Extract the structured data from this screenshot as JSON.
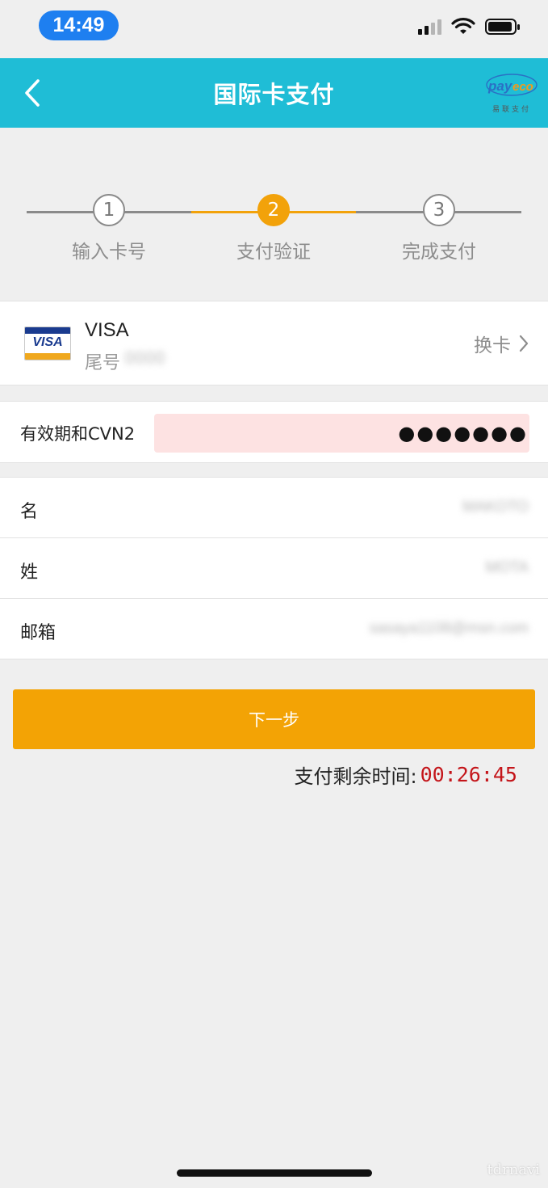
{
  "status_bar": {
    "time": "14:49",
    "icons": [
      "cellular-signal-icon",
      "wifi-icon",
      "battery-icon"
    ]
  },
  "nav": {
    "title": "国际卡支付",
    "back_icon": "chevron-left-icon",
    "logo_text": "payeco",
    "logo_subtext": "易联支付"
  },
  "steps": {
    "current": 2,
    "items": [
      {
        "number": "1",
        "label": "输入卡号",
        "state": "done"
      },
      {
        "number": "2",
        "label": "支付验证",
        "state": "active"
      },
      {
        "number": "3",
        "label": "完成支付",
        "state": "pending"
      }
    ]
  },
  "card": {
    "brand": "VISA",
    "logo_text": "VISA",
    "tail_label": "尾号",
    "tail_value": "0000",
    "change_label": "换卡",
    "change_icon": "chevron-right-icon"
  },
  "cvn": {
    "label": "有效期和CVN2",
    "masked_value": "●●●●●●●"
  },
  "personal_info": [
    {
      "label": "名",
      "value": "MAKOTO"
    },
    {
      "label": "姓",
      "value": "MOTA"
    },
    {
      "label": "邮箱",
      "value": "sasaya1108@msn.com"
    }
  ],
  "next_button": {
    "label": "下一步"
  },
  "timer": {
    "label": "支付剩余时间:",
    "value": "00:26:45"
  },
  "watermark": "tdrnavi",
  "colors": {
    "nav_bg": "#1fbdd6",
    "accent": "#f3a305",
    "timer": "#c4151a",
    "time_pill": "#1e7ff0"
  }
}
